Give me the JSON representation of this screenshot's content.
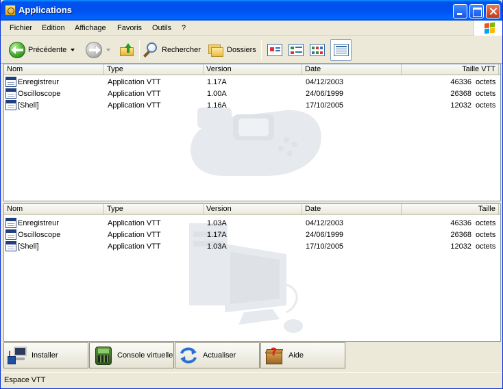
{
  "window": {
    "title": "Applications"
  },
  "menu": [
    "Fichier",
    "Edition",
    "Affichage",
    "Favoris",
    "Outils",
    "?"
  ],
  "toolbar": {
    "back_label": "Précédente",
    "search_label": "Rechercher",
    "folders_label": "Dossiers"
  },
  "top_panel": {
    "columns": [
      "Nom",
      "Type",
      "Version",
      "Date",
      "Taille VTT"
    ],
    "rows": [
      {
        "name": "Enregistreur",
        "type": "Application VTT",
        "version": "1.17A",
        "date": "04/12/2003",
        "size": "46336",
        "unit": "octets"
      },
      {
        "name": "Oscilloscope",
        "type": "Application VTT",
        "version": "1.00A",
        "date": "24/06/1999",
        "size": "26368",
        "unit": "octets"
      },
      {
        "name": "[Shell]",
        "type": "Application VTT",
        "version": "1.16A",
        "date": "17/10/2005",
        "size": "12032",
        "unit": "octets"
      }
    ]
  },
  "bottom_panel": {
    "columns": [
      "Nom",
      "Type",
      "Version",
      "Date",
      "Taille"
    ],
    "rows": [
      {
        "name": "Enregistreur",
        "type": "Application VTT",
        "version": "1.03A",
        "date": "04/12/2003",
        "size": "46336",
        "unit": "octets"
      },
      {
        "name": "Oscilloscope",
        "type": "Application VTT",
        "version": "1.17A",
        "date": "24/06/1999",
        "size": "26368",
        "unit": "octets"
      },
      {
        "name": "[Shell]",
        "type": "Application VTT",
        "version": "1.03A",
        "date": "17/10/2005",
        "size": "12032",
        "unit": "octets"
      }
    ]
  },
  "actions": [
    "Installer",
    "Console virtuelle",
    "Actualiser",
    "Aide"
  ],
  "status": {
    "text": "Espace VTT"
  },
  "colors": {
    "title_bar": "#0050ee",
    "chrome": "#ece9d8",
    "panel_border": "#7f9db9"
  }
}
